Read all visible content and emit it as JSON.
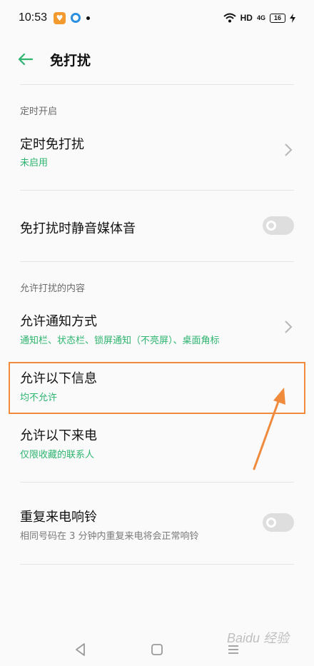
{
  "status_bar": {
    "time": "10:53",
    "app_badge": "♥",
    "network": "HD",
    "signal": "4G",
    "battery": "16"
  },
  "header": {
    "title": "免打扰"
  },
  "sections": {
    "scheduled": {
      "header": "定时开启",
      "scheduled_dnd": {
        "title": "定时免打扰",
        "subtitle": "未启用"
      }
    },
    "mute_media": {
      "title": "免打扰时静音媒体音",
      "enabled": false
    },
    "allowed": {
      "header": "允许打扰的内容",
      "notification_style": {
        "title": "允许通知方式",
        "subtitle": "通知栏、状态栏、锁屏通知（不亮屏）、桌面角标"
      },
      "allow_messages": {
        "title": "允许以下信息",
        "subtitle": "均不允许"
      },
      "allow_calls": {
        "title": "允许以下来电",
        "subtitle": "仅限收藏的联系人"
      },
      "repeat_calls": {
        "title": "重复来电响铃",
        "subtitle": "相同号码在 3 分钟内重复来电将会正常响铃",
        "enabled": false
      }
    }
  },
  "annotation": {
    "color": "#f08a3c"
  },
  "colors": {
    "accent": "#2db46f"
  },
  "watermark": "Baidu 经验"
}
